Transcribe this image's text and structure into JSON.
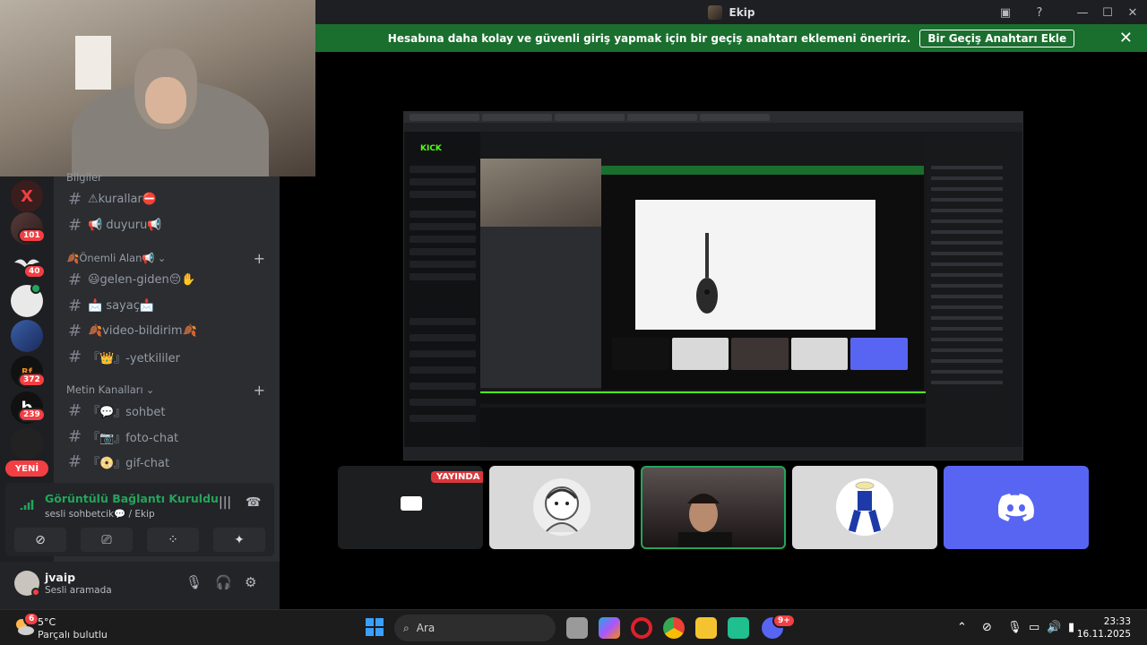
{
  "window": {
    "title": "Ekip"
  },
  "banner": {
    "message": "Hesabına daha kolay ve güvenli giriş yapmak için bir geçiş anahtarı eklemeni öneririz.",
    "button": "Bir Geçiş Anahtarı Ekle"
  },
  "guilds": {
    "badges": [
      "101",
      "40",
      "372",
      "239"
    ],
    "new_label": "YENİ"
  },
  "channels": {
    "top_partial": "Bilgiler",
    "list1": [
      {
        "name": "⚠kurallar⛔"
      },
      {
        "name": "📢 duyuru📢"
      }
    ],
    "category1": "🍂Önemli Alan📢",
    "list2": [
      {
        "name": "😃gelen-giden😔✋"
      },
      {
        "name": "📩 sayaç📩"
      },
      {
        "name": "🍂video-bildirim🍂"
      },
      {
        "name": "『👑』-yetkililer"
      }
    ],
    "category2": "Metin Kanalları",
    "list3": [
      {
        "name": "『💬』sohbet"
      },
      {
        "name": "『📷』foto-chat"
      },
      {
        "name": "『📀』gif-chat"
      }
    ]
  },
  "voice_panel": {
    "status": "Görüntülü Bağlantı Kuruldu",
    "channel": "sesli sohbetcik💬 / Ekip"
  },
  "user": {
    "name": "jvaip",
    "status": "Sesli aramada"
  },
  "stage": {
    "live_label": "YAYINDA"
  },
  "screenshare": {
    "logo": "KICK"
  },
  "taskbar": {
    "weather_temp": "5°C",
    "weather_desc": "Parçalı bulutlu",
    "search_placeholder": "Ara",
    "time": "23:33",
    "date": "16.11.2025",
    "discord_badge": "9+",
    "weather_badge": "6"
  },
  "colors": {
    "accent_green": "#23a55a",
    "banner_green": "#1a6e2e",
    "discord_blurple": "#5865f2",
    "alert_red": "#f23f43"
  }
}
